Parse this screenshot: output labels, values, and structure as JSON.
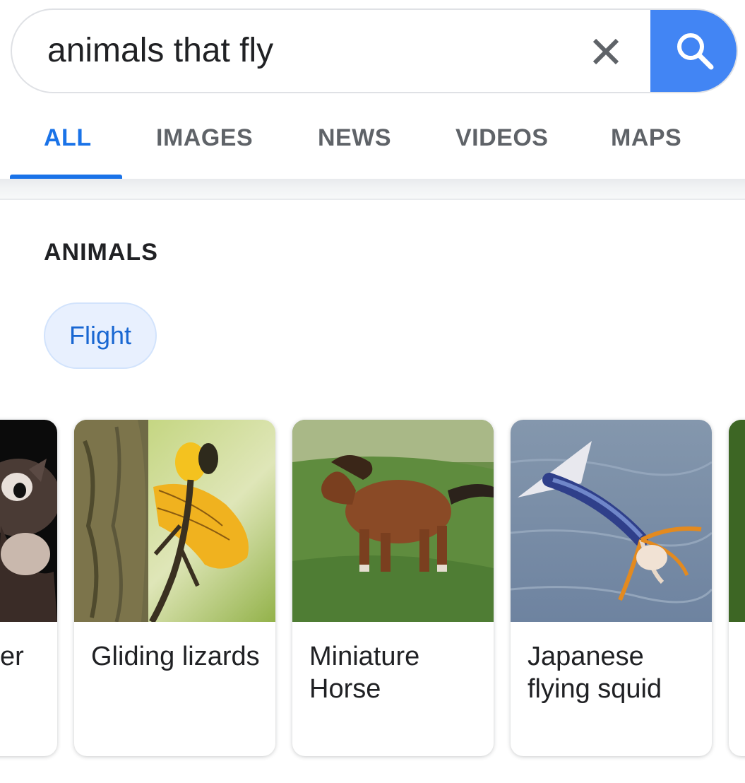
{
  "search": {
    "query": "animals that fly"
  },
  "tabs": [
    {
      "label": "ALL"
    },
    {
      "label": "IMAGES"
    },
    {
      "label": "NEWS"
    },
    {
      "label": "VIDEOS"
    },
    {
      "label": "MAPS"
    }
  ],
  "active_tab": "ALL",
  "section": {
    "title": "ANIMALS",
    "chip": "Flight"
  },
  "cards": [
    {
      "label": "er"
    },
    {
      "label": "Gliding lizards"
    },
    {
      "label": "Miniature Horse"
    },
    {
      "label": "Japanese flying squid"
    }
  ],
  "colors": {
    "accent": "#1a73e8",
    "search_button": "#4285f4",
    "chip_bg": "#e8f0fe"
  }
}
